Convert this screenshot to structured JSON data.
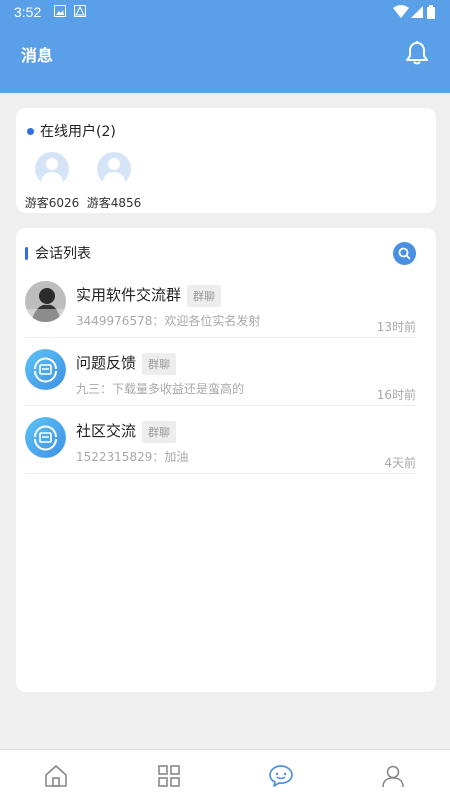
{
  "status_bar": {
    "time": "3:52"
  },
  "header": {
    "title": "消息"
  },
  "online": {
    "title": "在线用户(2)",
    "users": [
      {
        "name": "游客6026"
      },
      {
        "name": "游客4856"
      }
    ]
  },
  "sessions": {
    "title": "会话列表",
    "items": [
      {
        "name": "实用软件交流群",
        "tag": "群聊",
        "message": "3449976578：欢迎各位实名发射",
        "time": "13时前",
        "avatar": "photo"
      },
      {
        "name": "问题反馈",
        "tag": "群聊",
        "message": "九三：下载量多收益还是蛮高的",
        "time": "16时前",
        "avatar": "app-logo"
      },
      {
        "name": "社区交流",
        "tag": "群聊",
        "message": "1522315829：加油",
        "time": "4天前",
        "avatar": "app-logo"
      }
    ]
  },
  "tabbar": {
    "tabs": [
      {
        "icon": "home-icon"
      },
      {
        "icon": "grid-icon"
      },
      {
        "icon": "chat-icon",
        "active": true
      },
      {
        "icon": "profile-icon"
      }
    ]
  },
  "colors": {
    "brand": "#5aa0e8",
    "accent": "#2f6fe4",
    "active_tab": "#4a90e2"
  }
}
